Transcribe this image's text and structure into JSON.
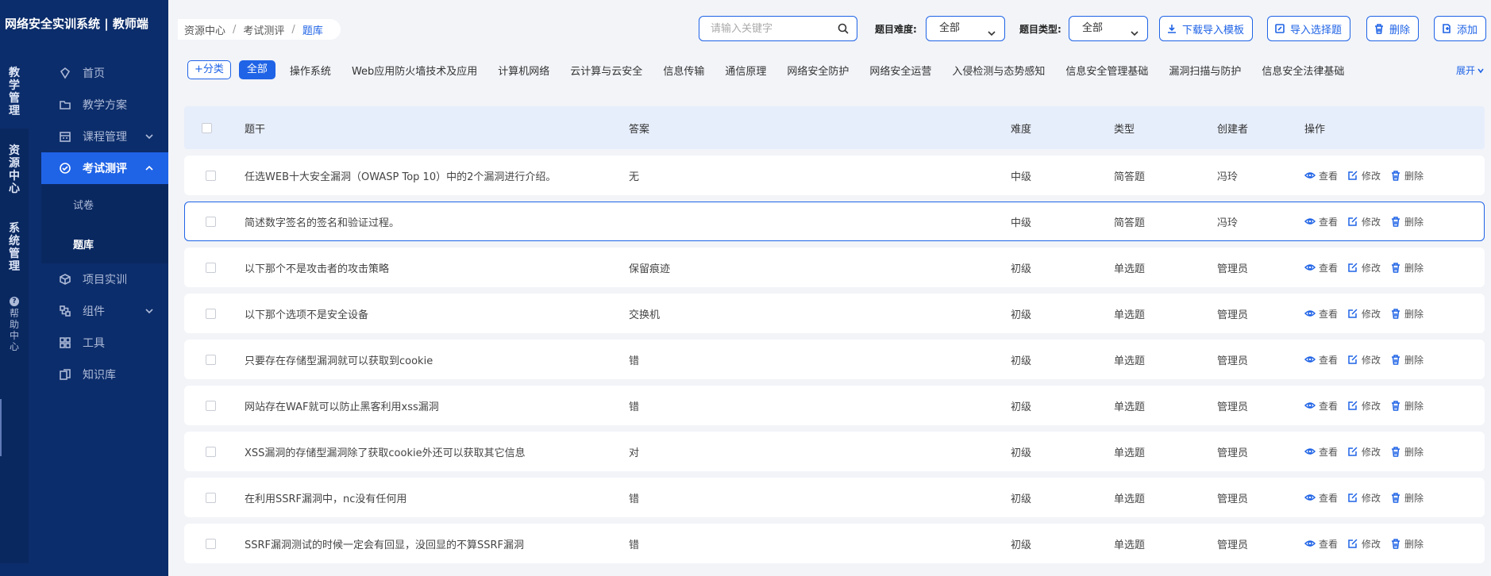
{
  "app": {
    "title": "网络安全实训系统 | 教师端"
  },
  "rail": [
    {
      "label": [
        "教",
        "学",
        "管",
        "理"
      ]
    },
    {
      "label": [
        "资",
        "源",
        "中",
        "心"
      ]
    },
    {
      "label": [
        "系",
        "统",
        "管",
        "理"
      ]
    },
    {
      "label": [
        "帮",
        "助",
        "中",
        "心"
      ],
      "badge": "?"
    }
  ],
  "menu": {
    "home": "首页",
    "plan": "教学方案",
    "course": "课程管理",
    "exam": "考试测评",
    "exam_sub": [
      "试卷",
      "题库"
    ],
    "project": "项目实训",
    "component": "组件",
    "tools": "工具",
    "knowledge": "知识库"
  },
  "breadcrumb": [
    "资源中心",
    "考试测评",
    "题库"
  ],
  "breadcrumb_sep": "/",
  "search": {
    "placeholder": "请输入关键字"
  },
  "filters": {
    "difficulty_label": "题目难度:",
    "difficulty_value": "全部",
    "type_label": "题目类型:",
    "type_value": "全部"
  },
  "toolbar": {
    "download": "下载导入模板",
    "import": "导入选择题",
    "delete": "删除",
    "add": "添加"
  },
  "categories": {
    "add": "+分类",
    "items": [
      "全部",
      "操作系统",
      "Web应用防火墙技术及应用",
      "计算机网络",
      "云计算与云安全",
      "信息传输",
      "通信原理",
      "网络安全防护",
      "网络安全运营",
      "入侵检测与态势感知",
      "信息安全管理基础",
      "漏洞扫描与防护",
      "信息安全法律基础"
    ],
    "expand": "展开"
  },
  "table": {
    "headers": {
      "question": "题干",
      "answer": "答案",
      "difficulty": "难度",
      "type": "类型",
      "creator": "创建者",
      "actions": "操作"
    },
    "action_labels": {
      "view": "查看",
      "edit": "修改",
      "delete": "删除"
    },
    "rows": [
      {
        "question": "任选WEB十大安全漏洞（OWASP Top 10）中的2个漏洞进行介绍。",
        "answer": "无",
        "difficulty": "中级",
        "type": "简答题",
        "creator": "冯玲"
      },
      {
        "question": "简述数字签名的签名和验证过程。",
        "answer": "",
        "difficulty": "中级",
        "type": "简答题",
        "creator": "冯玲",
        "selected": true
      },
      {
        "question": "以下那个不是攻击者的攻击策略",
        "answer": "保留痕迹",
        "difficulty": "初级",
        "type": "单选题",
        "creator": "管理员"
      },
      {
        "question": "以下那个选项不是安全设备",
        "answer": "交换机",
        "difficulty": "初级",
        "type": "单选题",
        "creator": "管理员"
      },
      {
        "question": "只要存在存储型漏洞就可以获取到cookie",
        "answer": "错",
        "difficulty": "初级",
        "type": "单选题",
        "creator": "管理员"
      },
      {
        "question": "网站存在WAF就可以防止黑客利用xss漏洞",
        "answer": "错",
        "difficulty": "初级",
        "type": "单选题",
        "creator": "管理员"
      },
      {
        "question": "XSS漏洞的存储型漏洞除了获取cookie外还可以获取其它信息",
        "answer": "对",
        "difficulty": "初级",
        "type": "单选题",
        "creator": "管理员"
      },
      {
        "question": "在利用SSRF漏洞中，nc没有任何用",
        "answer": "错",
        "difficulty": "初级",
        "type": "单选题",
        "creator": "管理员"
      },
      {
        "question": "SSRF漏洞测试的时候一定会有回显，没回显的不算SSRF漏洞",
        "answer": "错",
        "difficulty": "初级",
        "type": "单选题",
        "creator": "管理员"
      }
    ]
  },
  "colors": {
    "sidebar": "#0c2d6b",
    "accent": "#1f63e6",
    "header_row": "#e7eefb"
  }
}
